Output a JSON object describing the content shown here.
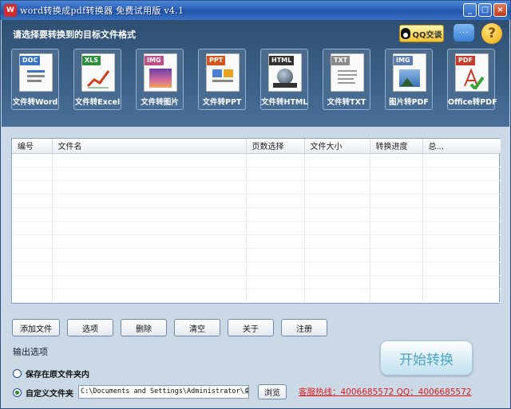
{
  "window": {
    "title": "word转换成pdf转换器 免费试用版 v4.1",
    "controls": {
      "minimize": "_",
      "maximize": "□",
      "close": "×"
    }
  },
  "header": {
    "title": "请选择要转换到的目标文件格式",
    "qq_button": "QQ交谈",
    "chat_icon": "chat-bubble-icon",
    "help_icon": "?"
  },
  "formats": [
    {
      "tag": "DOC",
      "label": "文件转Word",
      "color": "#3a72c4"
    },
    {
      "tag": "XLS",
      "label": "文件转Excel",
      "color": "#2f8f3c"
    },
    {
      "tag": "IMG",
      "label": "文件转图片",
      "color": "#c0508a"
    },
    {
      "tag": "PPT",
      "label": "文件转PPT",
      "color": "#d2541f"
    },
    {
      "tag": "HTML",
      "label": "文件转HTML",
      "color": "#333333"
    },
    {
      "tag": "TXT",
      "label": "文件转TXT",
      "color": "#8a8a8a"
    },
    {
      "tag": "IMG",
      "label": "图片转PDF",
      "color": "#5a7fb0"
    },
    {
      "tag": "PDF",
      "label": "Office转PDF",
      "color": "#c83a2a"
    }
  ],
  "table": {
    "columns": [
      "编号",
      "文件名",
      "页数选择",
      "文件大小",
      "转换进度",
      "总..."
    ],
    "rows": []
  },
  "buttons": {
    "add": "添加文件",
    "options": "选项",
    "delete": "删除",
    "clear": "清空",
    "about": "关于",
    "register": "注册",
    "start": "开始转换",
    "browse": "浏览"
  },
  "output": {
    "section_label": "输出选项",
    "save_original": "保存在原文件夹内",
    "custom_folder": "自定义文件夹",
    "path": "C:\\Documents and Settings\\Administrator\\桌面",
    "selected": "custom"
  },
  "hotline": "客服热线：4006685572 QQ：4006685572"
}
